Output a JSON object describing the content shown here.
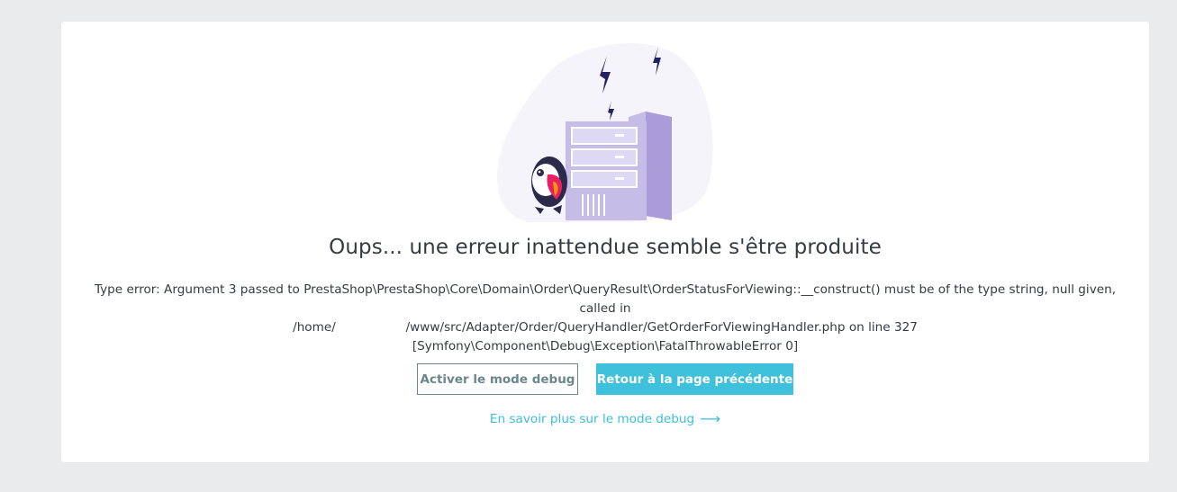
{
  "error_page": {
    "title": "Oups... une erreur inattendue semble s'être produite",
    "message_lines": [
      "Type error: Argument 3 passed to PrestaShop\\PrestaShop\\Core\\Domain\\Order\\QueryResult\\OrderStatusForViewing::__construct() must be of the type string, null given, called in",
      "/home/                  /www/src/Adapter/Order/QueryHandler/GetOrderForViewingHandler.php on line 327",
      "[Symfony\\Component\\Debug\\Exception\\FatalThrowableError 0]"
    ],
    "debug_button_label": "Activer le mode debug",
    "back_button_label": "Retour à la page précédente",
    "learn_more_link": "En savoir plus sur le mode debug",
    "learn_more_arrow": "⟶"
  },
  "colors": {
    "background": "#eaebed",
    "card": "#ffffff",
    "primary": "#25b9d7",
    "text": "#363a41",
    "secondary": "#6c868e",
    "server_purple": "#c5bde8",
    "lightning": "#25205e"
  },
  "illustration": {
    "icon": "server-error-puffin-illustration"
  }
}
